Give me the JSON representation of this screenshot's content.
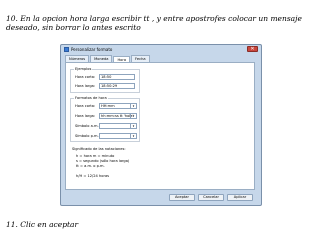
{
  "captions": {
    "top": "10. En la opcion hora larga escribir tt , y entre  apostrofes colocar un mensaje deseado, sin borrar lo  antes escrito",
    "bottom": "11. Clic en aceptar"
  },
  "dialog": {
    "title": "Personalizar formato",
    "close_label": "✕",
    "tabs": [
      "Números",
      "Moneda",
      "Hora",
      "Fecha"
    ],
    "active_tab": "Hora",
    "examples": {
      "group_label": "Ejemplos",
      "short_label": "Hora corta:",
      "short_value": "18:50",
      "long_label": "Hora larga:",
      "long_value": "18:50:29"
    },
    "formats": {
      "group_label": "Formatos de hora",
      "short_label": "Hora corta:",
      "short_value": "HH:mm",
      "long_label": "Hora larga:",
      "long_value": "hh:mm:ss tt 'hola'",
      "am_label": "Símbolo a.m.:",
      "am_value": "",
      "pm_label": "Símbolo p.m.:",
      "pm_value": ""
    },
    "notes": {
      "title": "Significado de las notaciones:",
      "lines": [
        "h = hora   m = minuto",
        "s = segundo (sólo hora larga)",
        "tt = a.m. o p.m.",
        "",
        "h/H = 12/24 horas"
      ]
    },
    "buttons": {
      "accept": "Aceptar",
      "cancel": "Cancelar",
      "apply": "Aplicar"
    }
  }
}
